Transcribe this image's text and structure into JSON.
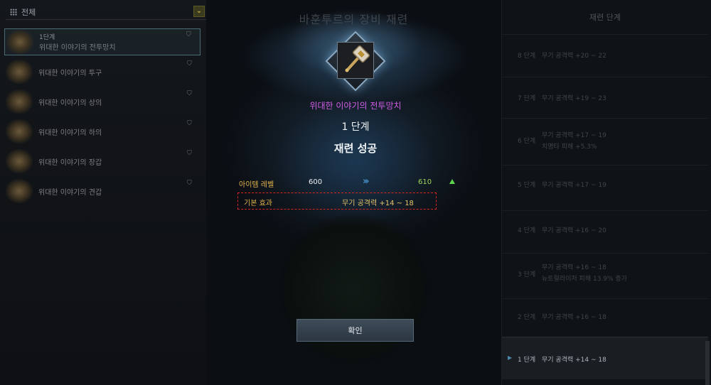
{
  "left_panel": {
    "filter_label": "전체",
    "items": [
      {
        "level": "1단계",
        "name": "위대한 이야기의 전투망치"
      },
      {
        "level": "",
        "name": "위대한 이야기의 투구"
      },
      {
        "level": "",
        "name": "위대한 이야기의 상의"
      },
      {
        "level": "",
        "name": "위대한 이야기의 하의"
      },
      {
        "level": "",
        "name": "위대한 이야기의 장갑"
      },
      {
        "level": "",
        "name": "위대한 이야기의 견갑"
      }
    ]
  },
  "center": {
    "bg_title": "바훈투르의 장비 재련"
  },
  "right_panel": {
    "title": "재련 단계",
    "stages": [
      {
        "label": "8 단계",
        "effects": [
          "무기 공격력 +20 ~ 22"
        ]
      },
      {
        "label": "7 단계",
        "effects": [
          "무기 공격력 +19 ~ 23"
        ]
      },
      {
        "label": "6 단계",
        "effects": [
          "무기 공격력 +17 ~ 19",
          "치명타 피해 +5.3%"
        ]
      },
      {
        "label": "5 단계",
        "effects": [
          "무기 공격력 +17 ~ 19"
        ]
      },
      {
        "label": "4 단계",
        "effects": [
          "무기 공격력 +16 ~ 20"
        ]
      },
      {
        "label": "3 단계",
        "effects": [
          "무기 공격력 +16 ~ 18",
          "뉴트럴라이저 피해 13.9% 증가"
        ]
      },
      {
        "label": "2 단계",
        "effects": [
          "무기 공격력 +16 ~ 18"
        ]
      },
      {
        "label": "1 단계",
        "effects": [
          "무기 공격력 +14 ~ 18"
        ]
      }
    ]
  },
  "modal": {
    "item_name": "위대한 이야기의 전투망치",
    "stage": "1 단계",
    "result": "재련 성공",
    "item_level_label": "아이템 레벨",
    "item_level_before": "600",
    "item_level_arrows": "›››",
    "item_level_after": "610",
    "base_effect_label": "기본 효과",
    "base_effect_value": "무기 공격력 +14 ~ 18",
    "confirm_label": "확인"
  },
  "colors": {
    "item_name": "#d25ce6",
    "stat_label": "#e0b34a",
    "level_after": "#9fd35a",
    "highlight_box": "#d6261f"
  },
  "icons": [
    "grid-icon",
    "chevron-down-icon",
    "lock-icon",
    "warhammer-icon",
    "arrow-up-icon"
  ]
}
